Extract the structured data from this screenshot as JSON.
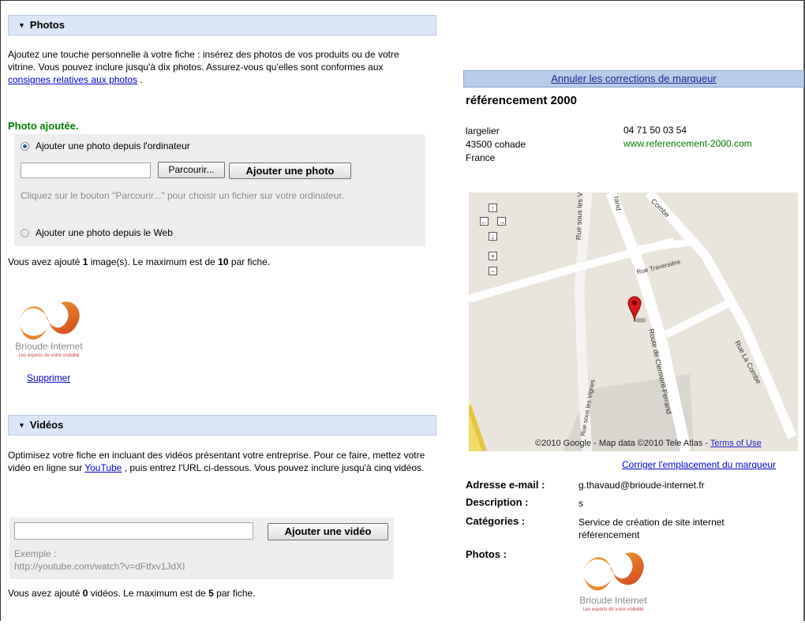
{
  "photos": {
    "header": "Photos",
    "intro": "Ajoutez une touche personnelle à votre fiche : insérez des photos de vos produits ou de votre vitrine. Vous pouvez inclure jusqu'à dix photos. Assurez-vous qu'elles sont conformes aux",
    "intro_link": "consignes relatives aux photos",
    "intro_end": ".",
    "added_msg": "Photo ajoutée.",
    "option_computer": "Ajouter une photo depuis l'ordinateur",
    "browse_label": "Parcourir...",
    "add_photo_label": "Ajouter une photo",
    "hint": "Cliquez sur le bouton \"Parcourir...\" pour choisir un fichier sur votre ordinateur.",
    "option_web": "Ajouter une photo depuis le Web",
    "count_pre": "Vous avez ajouté ",
    "count": "1",
    "count_mid": " image(s). Le maximum est de ",
    "max": "10",
    "count_post": " par fiche.",
    "delete_label": "Supprimer"
  },
  "logo": {
    "name": "Brioude Internet",
    "tagline": "Les experts de votre visibilité"
  },
  "videos": {
    "header": "Vidéos",
    "intro": "Optimisez votre fiche en incluant des vidéos présentant votre entreprise. Pour ce faire, mettez votre vidéo en ligne sur",
    "youtube_link": "YouTube",
    "intro_end": ", puis entrez l'URL ci-dessous. Vous pouvez inclure jusqu'à cinq vidéos.",
    "add_video_label": "Ajouter une vidéo",
    "example_label": "Exemple :",
    "example_url": "http://youtube.com/watch?v=dFtfxv1JdXI",
    "count_pre": "Vous avez ajouté ",
    "count": "0",
    "count_mid": " vidéos. Le maximum est de ",
    "max": "5",
    "count_post": " par fiche."
  },
  "listing": {
    "cancel_link": "Annuler les corrections de marqueur",
    "name": "référencement 2000",
    "address_line1": "largelier",
    "address_line2": "43500 cohade",
    "address_line3": "France",
    "phone": "04 71 50 03 54",
    "website": "www.referencement-2000.com",
    "map_credit": "©2010 Google - Map data ©2010 Tele Atlas -",
    "map_terms": "Terms of Use",
    "correct_marker_link": "Corriger l'emplacement du marqueur",
    "email_label": "Adresse e-mail :",
    "email": "g.thavaud@brioude-internet.fr",
    "description_label": "Description :",
    "description": "s",
    "categories_label": "Catégories :",
    "category1": "Service de création de site internet",
    "category2": "référencement",
    "photos_label": "Photos :"
  },
  "map_streets": {
    "s1": "Rue sous les Vignes",
    "s2": "Rue Traversière",
    "s3": "Route de Clermont-Ferrand",
    "s4": "Rue La Combe",
    "s5": "Rue sous les Vignes",
    "s6": "rand",
    "s7": "Combe"
  },
  "colors": {
    "header_bg": "#dbe6f7",
    "success_green": "#008000",
    "link_blue": "#0000cc",
    "marker_red": "#d21a1a"
  }
}
